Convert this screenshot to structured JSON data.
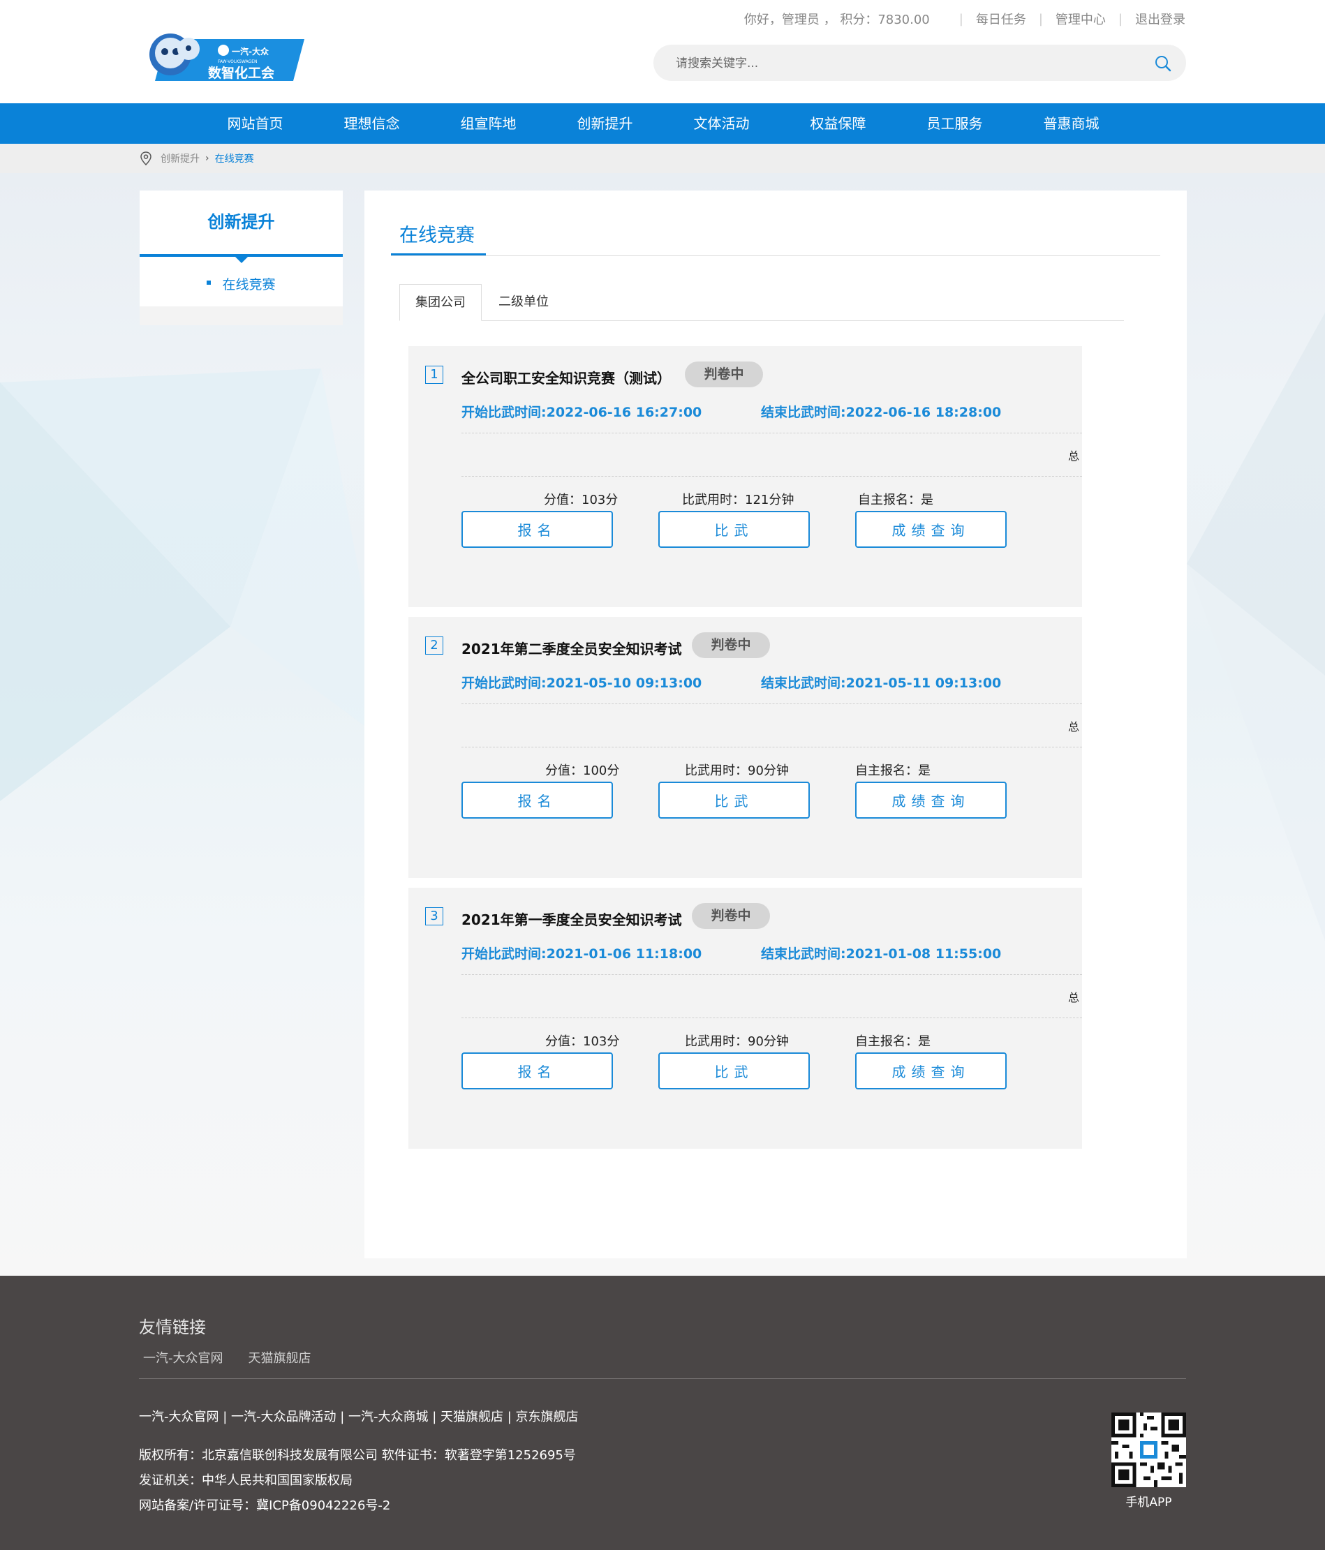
{
  "header": {
    "logo_brand_text": "一汽-大众",
    "logo_sub_text": "FAW-VOLKSWAGEN",
    "logo_title": "数智化工会",
    "greeting": "你好，管理员 ，  积分：7830.00",
    "links": [
      "每日任务",
      "管理中心",
      "退出登录"
    ],
    "search_placeholder": "请搜索关键字..."
  },
  "nav": [
    "网站首页",
    "理想信念",
    "组宣阵地",
    "创新提升",
    "文体活动",
    "权益保障",
    "员工服务",
    "普惠商城"
  ],
  "breadcrumb": {
    "parent": "创新提升",
    "current": "在线竞赛"
  },
  "sidebar": {
    "title": "创新提升",
    "item": "在线竞赛"
  },
  "main": {
    "title": "在线竞赛",
    "tabs": [
      "集团公司",
      "二级单位"
    ],
    "active_tab": "集团公司"
  },
  "buttons": {
    "signup": "报名",
    "compete": "比武",
    "score": "成绩查询"
  },
  "total_label": "总",
  "competitions": [
    {
      "num": "1",
      "title": "全公司职工安全知识竞赛（测试）",
      "status": "判卷中",
      "start": "开始比武时间:2022-06-16 16:27:00",
      "end": "结束比武时间:2022-06-16 18:28:00",
      "score": "分值：103分",
      "duration": "比武用时：121分钟",
      "self_signup": "自主报名：是"
    },
    {
      "num": "2",
      "title": "2021年第二季度全员安全知识考试",
      "status": "判卷中",
      "start": "开始比武时间:2021-05-10 09:13:00",
      "end": "结束比武时间:2021-05-11 09:13:00",
      "score": "分值：100分",
      "duration": "比武用时：90分钟",
      "self_signup": "自主报名：是"
    },
    {
      "num": "3",
      "title": "2021年第一季度全员安全知识考试",
      "status": "判卷中",
      "start": "开始比武时间:2021-01-06 11:18:00",
      "end": "结束比武时间:2021-01-08 11:55:00",
      "score": "分值：103分",
      "duration": "比武用时：90分钟",
      "self_signup": "自主报名：是"
    }
  ],
  "footer": {
    "friend_title": "友情链接",
    "friend_links": [
      "一汽-大众官网",
      "天猫旗舰店"
    ],
    "site_links": "一汽-大众官网 | 一汽-大众品牌活动 | 一汽-大众商城 | 天猫旗舰店 | 京东旗舰店",
    "copyright": "版权所有：北京嘉信联创科技发展有限公司 软件证书：软著登字第1252695号",
    "issuer": "发证机关：中华人民共和国国家版权局",
    "icp": "网站备案/许可证号：冀ICP备09042226号-2",
    "app_label": "手机APP"
  },
  "colors": {
    "primary": "#0a82d8",
    "link_blue": "#1a8ad8",
    "footer_bg": "#4a4646",
    "card_bg": "#f3f3f3"
  }
}
